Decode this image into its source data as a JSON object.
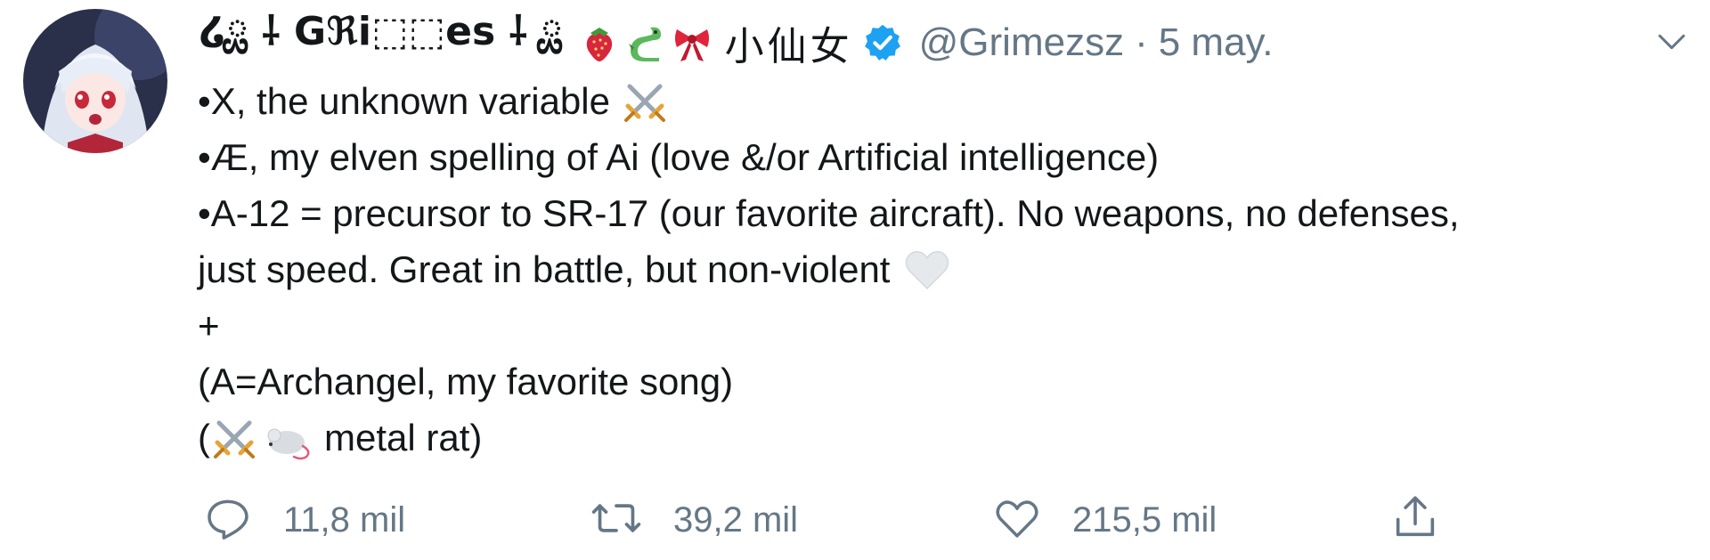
{
  "tweet": {
    "display_name": "໒ྏ ⸸ Gℜi⬚⬚es ⸸ ྏ",
    "name_emojis": [
      "strawberry",
      "dragon",
      "ribbon"
    ],
    "name_cjk": "小仙女",
    "verified": true,
    "handle": "@Grimezsz",
    "separator": "·",
    "date": "5 may.",
    "body": {
      "line1": "•X, the unknown variable",
      "line2": "•Æ, my elven spelling of Ai (love &/or Artificial intelligence)",
      "line3": "•A-12 = precursor to SR-17 (our favorite aircraft).  No weapons, no defenses,",
      "line4": "just speed.  Great in battle, but non-violent",
      "line5": "+",
      "line6": "(A=Archangel, my favorite song)",
      "line7_open": "(",
      "line7_text": "metal rat)"
    },
    "emojis": {
      "line1": "crossed-swords",
      "line4": "white-heart",
      "line7": [
        "crossed-swords",
        "mouse"
      ]
    }
  },
  "actions": {
    "reply_count": "11,8 mil",
    "retweet_count": "39,2 mil",
    "like_count": "215,5 mil"
  },
  "colors": {
    "text": "#14171a",
    "secondary": "#657786",
    "verified": "#1da1f2"
  }
}
